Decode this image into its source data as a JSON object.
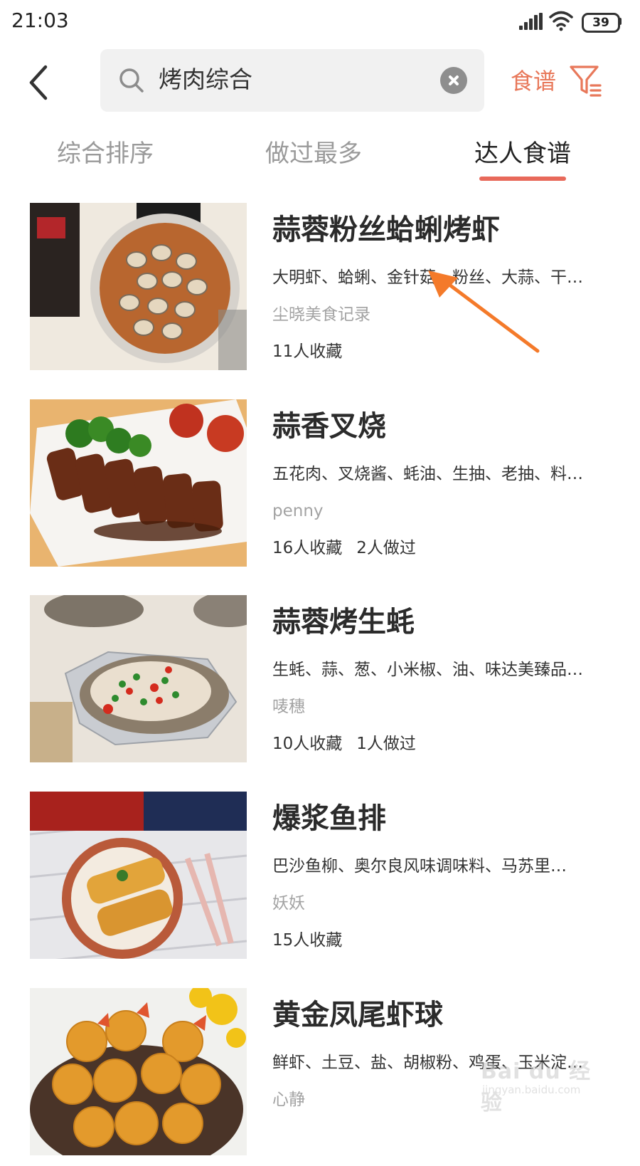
{
  "status_bar": {
    "time": "21:03",
    "battery": "39"
  },
  "search": {
    "query": "烤肉综合"
  },
  "filter": {
    "label": "食谱"
  },
  "tabs": [
    {
      "label": "综合排序",
      "active": false
    },
    {
      "label": "做过最多",
      "active": false
    },
    {
      "label": "达人食谱",
      "active": true
    }
  ],
  "recipes": [
    {
      "title": "蒜蓉粉丝蛤蜊烤虾",
      "ingredients": "大明虾、蛤蜊、金针菇、粉丝、大蒜、干…",
      "author": "尘晓美食记录",
      "favorites": "11人收藏",
      "made": ""
    },
    {
      "title": "蒜香叉烧",
      "ingredients": "五花肉、叉烧酱、蚝油、生抽、老抽、料…",
      "author": "penny",
      "favorites": "16人收藏",
      "made": "2人做过"
    },
    {
      "title": "蒜蓉烤生蚝",
      "ingredients": "生蚝、蒜、葱、小米椒、油、味达美臻品…",
      "author": "唛穗",
      "favorites": "10人收藏",
      "made": "1人做过"
    },
    {
      "title": "爆浆鱼排",
      "ingredients": "巴沙鱼柳、奥尔良风味调味料、马苏里…",
      "author": "妖妖",
      "favorites": "15人收藏",
      "made": ""
    },
    {
      "title": "黄金凤尾虾球",
      "ingredients": "鲜虾、土豆、盐、胡椒粉、鸡蛋、玉米淀…",
      "author": "心静",
      "favorites": "",
      "made": ""
    }
  ],
  "watermark": {
    "logo": "Bai du 经验",
    "url": "jingyan.baidu.com"
  },
  "colors": {
    "accent": "#e8695a",
    "filter": "#e8785a",
    "annotation_arrow": "#f47a2a"
  }
}
